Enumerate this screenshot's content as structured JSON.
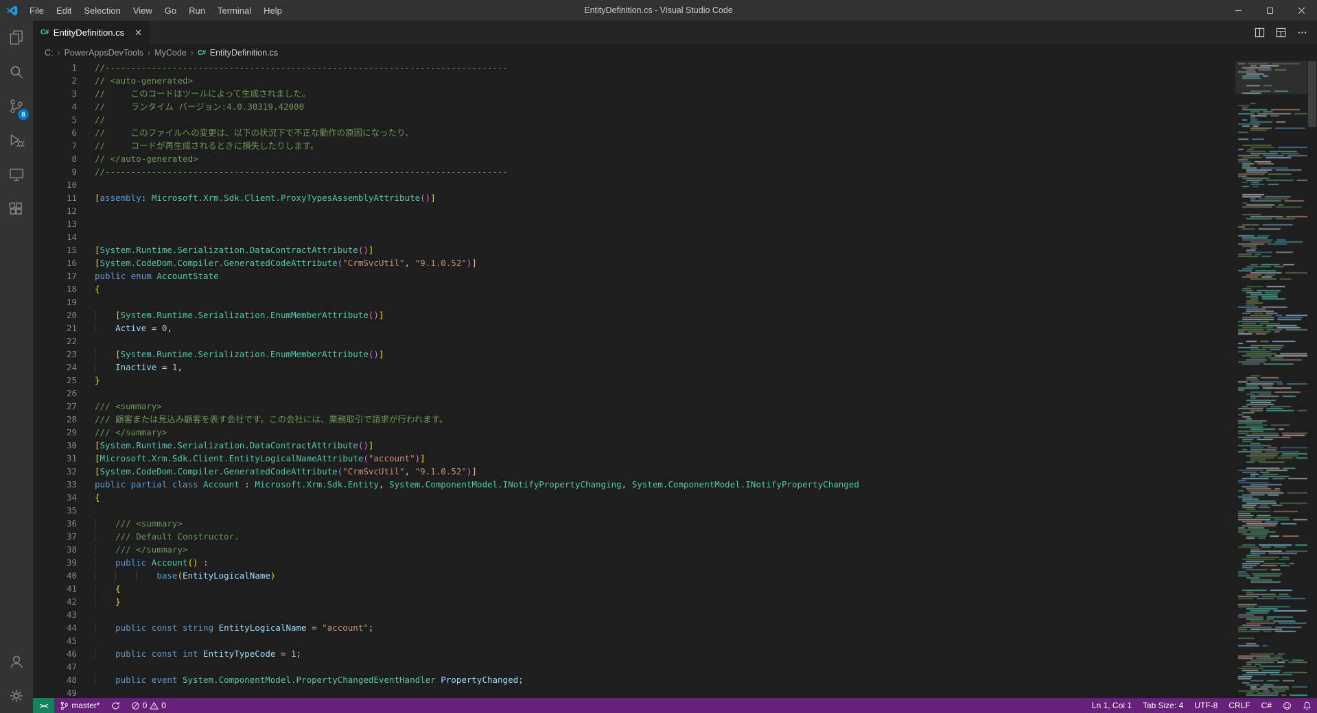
{
  "titlebar": {
    "title": "EntityDefinition.cs - Visual Studio Code",
    "menus": [
      "File",
      "Edit",
      "Selection",
      "View",
      "Go",
      "Run",
      "Terminal",
      "Help"
    ]
  },
  "activity_bar": {
    "scm_badge": "8"
  },
  "tab": {
    "label": "EntityDefinition.cs"
  },
  "icons": {
    "csharp": "C#",
    "remote_glyph": "><"
  },
  "breadcrumbs": [
    "C:",
    "PowerAppsDevTools",
    "MyCode",
    "EntityDefinition.cs"
  ],
  "editor": {
    "lines": [
      {
        "n": 1,
        "t": [
          [
            "c",
            "//------------------------------------------------------------------------------"
          ]
        ]
      },
      {
        "n": 2,
        "t": [
          [
            "c",
            "// <auto-generated>"
          ]
        ]
      },
      {
        "n": 3,
        "t": [
          [
            "c",
            "//     このコードはツールによって生成されました。"
          ]
        ]
      },
      {
        "n": 4,
        "t": [
          [
            "c",
            "//     ランタイム バージョン:4.0.30319.42000"
          ]
        ]
      },
      {
        "n": 5,
        "t": [
          [
            "c",
            "//"
          ]
        ]
      },
      {
        "n": 6,
        "t": [
          [
            "c",
            "//     このファイルへの変更は、以下の状況下で不正な動作の原因になったり、"
          ]
        ]
      },
      {
        "n": 7,
        "t": [
          [
            "c",
            "//     コードが再生成されるときに損失したりします。"
          ]
        ]
      },
      {
        "n": 8,
        "t": [
          [
            "c",
            "// </auto-generated>"
          ]
        ]
      },
      {
        "n": 9,
        "t": [
          [
            "c",
            "//------------------------------------------------------------------------------"
          ]
        ]
      },
      {
        "n": 10,
        "t": []
      },
      {
        "n": 11,
        "t": [
          [
            "b1",
            "["
          ],
          [
            "k",
            "assembly"
          ],
          [
            "p",
            ": "
          ],
          [
            "t",
            "Microsoft.Xrm.Sdk.Client.ProxyTypesAssemblyAttribute"
          ],
          [
            "b2",
            "()"
          ],
          [
            "b1",
            "]"
          ]
        ]
      },
      {
        "n": 12,
        "t": []
      },
      {
        "n": 13,
        "t": []
      },
      {
        "n": 14,
        "t": []
      },
      {
        "n": 15,
        "t": [
          [
            "b1",
            "["
          ],
          [
            "t",
            "System.Runtime.Serialization.DataContractAttribute"
          ],
          [
            "b2",
            "()"
          ],
          [
            "b1",
            "]"
          ]
        ]
      },
      {
        "n": 16,
        "t": [
          [
            "b1",
            "["
          ],
          [
            "t",
            "System.CodeDom.Compiler.GeneratedCodeAttribute"
          ],
          [
            "b2",
            "("
          ],
          [
            "s",
            "\"CrmSvcUtil\""
          ],
          [
            "p",
            ", "
          ],
          [
            "s",
            "\"9.1.0.52\""
          ],
          [
            "b2",
            ")"
          ],
          [
            "b1",
            "]"
          ]
        ]
      },
      {
        "n": 17,
        "t": [
          [
            "k",
            "public enum "
          ],
          [
            "t",
            "AccountState"
          ]
        ]
      },
      {
        "n": 18,
        "t": [
          [
            "b1",
            "{"
          ]
        ]
      },
      {
        "n": 19,
        "t": []
      },
      {
        "n": 20,
        "t": [
          [
            "p",
            "    "
          ],
          [
            "b1",
            "["
          ],
          [
            "t",
            "System.Runtime.Serialization.EnumMemberAttribute"
          ],
          [
            "b2",
            "()"
          ],
          [
            "b1",
            "]"
          ]
        ]
      },
      {
        "n": 21,
        "t": [
          [
            "v",
            "    Active"
          ],
          [
            "p",
            " = "
          ],
          [
            "n",
            "0"
          ],
          [
            "p",
            ","
          ]
        ]
      },
      {
        "n": 22,
        "t": []
      },
      {
        "n": 23,
        "t": [
          [
            "p",
            "    "
          ],
          [
            "b1",
            "["
          ],
          [
            "t",
            "System.Runtime.Serialization.EnumMemberAttribute"
          ],
          [
            "b2",
            "()"
          ],
          [
            "b1",
            "]"
          ]
        ]
      },
      {
        "n": 24,
        "t": [
          [
            "v",
            "    Inactive"
          ],
          [
            "p",
            " = "
          ],
          [
            "n",
            "1"
          ],
          [
            "p",
            ","
          ]
        ]
      },
      {
        "n": 25,
        "t": [
          [
            "b1",
            "}"
          ]
        ]
      },
      {
        "n": 26,
        "t": []
      },
      {
        "n": 27,
        "t": [
          [
            "c",
            "/// <summary>"
          ]
        ]
      },
      {
        "n": 28,
        "t": [
          [
            "c",
            "/// 顧客または見込み顧客を表す会社です。この会社には、業務取引で請求が行われます。"
          ]
        ]
      },
      {
        "n": 29,
        "t": [
          [
            "c",
            "/// </summary>"
          ]
        ]
      },
      {
        "n": 30,
        "t": [
          [
            "b1",
            "["
          ],
          [
            "t",
            "System.Runtime.Serialization.DataContractAttribute"
          ],
          [
            "b2",
            "()"
          ],
          [
            "b1",
            "]"
          ]
        ]
      },
      {
        "n": 31,
        "t": [
          [
            "b1",
            "["
          ],
          [
            "t",
            "Microsoft.Xrm.Sdk.Client.EntityLogicalNameAttribute"
          ],
          [
            "b2",
            "("
          ],
          [
            "s",
            "\"account\""
          ],
          [
            "b2",
            ")"
          ],
          [
            "b1",
            "]"
          ]
        ]
      },
      {
        "n": 32,
        "t": [
          [
            "b1",
            "["
          ],
          [
            "t",
            "System.CodeDom.Compiler.GeneratedCodeAttribute"
          ],
          [
            "b2",
            "("
          ],
          [
            "s",
            "\"CrmSvcUtil\""
          ],
          [
            "p",
            ", "
          ],
          [
            "s",
            "\"9.1.0.52\""
          ],
          [
            "b2",
            ")"
          ],
          [
            "b1",
            "]"
          ]
        ]
      },
      {
        "n": 33,
        "t": [
          [
            "k",
            "public partial class "
          ],
          [
            "t",
            "Account"
          ],
          [
            "p",
            " : "
          ],
          [
            "t",
            "Microsoft.Xrm.Sdk.Entity"
          ],
          [
            "p",
            ", "
          ],
          [
            "t",
            "System.ComponentModel.INotifyPropertyChanging"
          ],
          [
            "p",
            ", "
          ],
          [
            "t",
            "System.ComponentModel.INotifyPropertyChanged"
          ]
        ]
      },
      {
        "n": 34,
        "t": [
          [
            "b1",
            "{"
          ]
        ]
      },
      {
        "n": 35,
        "t": []
      },
      {
        "n": 36,
        "t": [
          [
            "c",
            "    /// <summary>"
          ]
        ]
      },
      {
        "n": 37,
        "t": [
          [
            "c",
            "    /// Default Constructor."
          ]
        ]
      },
      {
        "n": 38,
        "t": [
          [
            "c",
            "    /// </summary>"
          ]
        ]
      },
      {
        "n": 39,
        "t": [
          [
            "k",
            "    public "
          ],
          [
            "t",
            "Account"
          ],
          [
            "b1",
            "()"
          ],
          [
            "p",
            " : "
          ]
        ]
      },
      {
        "n": 40,
        "t": [
          [
            "k",
            "            base"
          ],
          [
            "b1",
            "("
          ],
          [
            "v",
            "EntityLogicalName"
          ],
          [
            "b1",
            ")"
          ]
        ]
      },
      {
        "n": 41,
        "t": [
          [
            "b1",
            "    {"
          ]
        ]
      },
      {
        "n": 42,
        "t": [
          [
            "b1",
            "    }"
          ]
        ]
      },
      {
        "n": 43,
        "t": []
      },
      {
        "n": 44,
        "t": [
          [
            "k",
            "    public const string "
          ],
          [
            "v",
            "EntityLogicalName"
          ],
          [
            "p",
            " = "
          ],
          [
            "s",
            "\"account\""
          ],
          [
            "p",
            ";"
          ]
        ]
      },
      {
        "n": 45,
        "t": []
      },
      {
        "n": 46,
        "t": [
          [
            "k",
            "    public const int "
          ],
          [
            "v",
            "EntityTypeCode"
          ],
          [
            "p",
            " = "
          ],
          [
            "n",
            "1"
          ],
          [
            "p",
            ";"
          ]
        ]
      },
      {
        "n": 47,
        "t": []
      },
      {
        "n": 48,
        "t": [
          [
            "k",
            "    public event "
          ],
          [
            "t",
            "System.ComponentModel.PropertyChangedEventHandler"
          ],
          [
            "p",
            " "
          ],
          [
            "v",
            "PropertyChanged"
          ],
          [
            "p",
            ";"
          ]
        ]
      },
      {
        "n": 49,
        "t": []
      }
    ]
  },
  "status_bar": {
    "branch": "master*",
    "errors": "0",
    "warnings": "0",
    "cursor": "Ln 1, Col 1",
    "tab_size": "Tab Size: 4",
    "encoding": "UTF-8",
    "eol": "CRLF",
    "language": "C#"
  },
  "colors": {
    "accent": "#007ACC",
    "status_bar": "#68217A",
    "remote": "#16825D",
    "cs_icon": "#4EC9B0",
    "minimap_palette": [
      "#4EC9B0",
      "#6A9955",
      "#9CDCFE",
      "#CE9178",
      "#D4D4D4",
      "#569CD6"
    ]
  }
}
